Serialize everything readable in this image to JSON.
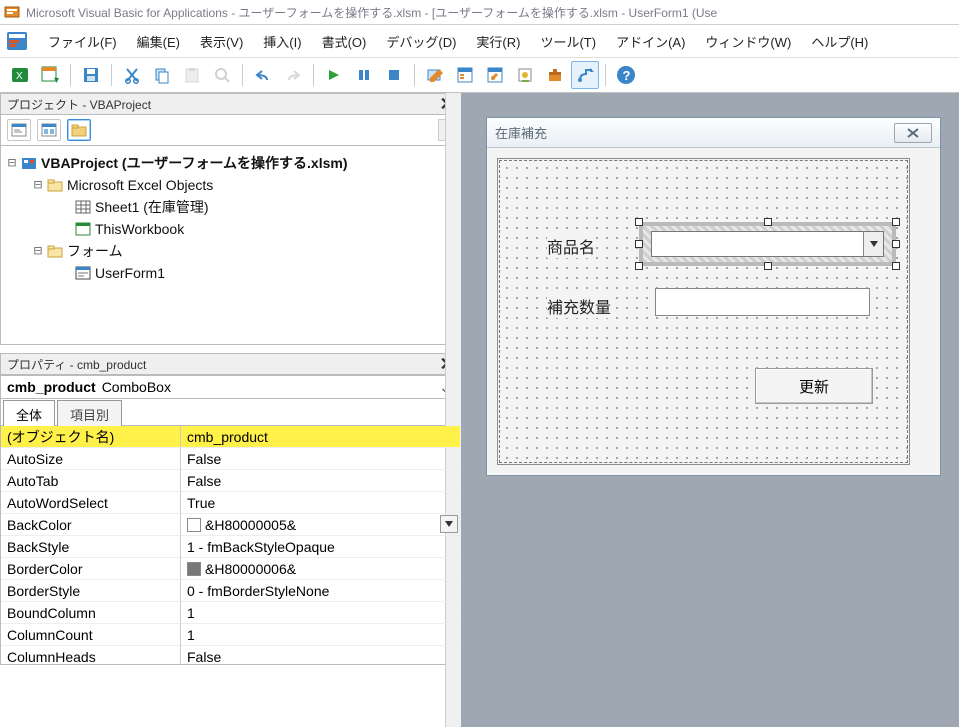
{
  "title": "Microsoft Visual Basic for Applications - ユーザーフォームを操作する.xlsm - [ユーザーフォームを操作する.xlsm - UserForm1 (Use",
  "menu": {
    "file": "ファイル(F)",
    "edit": "編集(E)",
    "view": "表示(V)",
    "insert": "挿入(I)",
    "format": "書式(O)",
    "debug": "デバッグ(D)",
    "run": "実行(R)",
    "tools": "ツール(T)",
    "addins": "アドイン(A)",
    "window": "ウィンドウ(W)",
    "help": "ヘルプ(H)"
  },
  "panels": {
    "project_title": "プロジェクト - VBAProject",
    "properties_title": "プロパティ - cmb_product"
  },
  "tree": {
    "root": "VBAProject (ユーザーフォームを操作する.xlsm)",
    "excel_objects": "Microsoft Excel Objects",
    "sheet1": "Sheet1 (在庫管理)",
    "thiswb": "ThisWorkbook",
    "forms": "フォーム",
    "userform1": "UserForm1"
  },
  "props": {
    "object_name": "cmb_product",
    "object_type": "ComboBox",
    "tab_all": "全体",
    "tab_cat": "項目別",
    "rows": [
      {
        "k": "(オブジェクト名)",
        "v": "cmb_product",
        "hl": true
      },
      {
        "k": "AutoSize",
        "v": "False"
      },
      {
        "k": "AutoTab",
        "v": "False"
      },
      {
        "k": "AutoWordSelect",
        "v": "True"
      },
      {
        "k": "BackColor",
        "v": "&H80000005&",
        "chip": "white",
        "dd": true
      },
      {
        "k": "BackStyle",
        "v": "1 - fmBackStyleOpaque"
      },
      {
        "k": "BorderColor",
        "v": "&H80000006&",
        "chip": "gray"
      },
      {
        "k": "BorderStyle",
        "v": "0 - fmBorderStyleNone"
      },
      {
        "k": "BoundColumn",
        "v": "1"
      },
      {
        "k": "ColumnCount",
        "v": "1"
      },
      {
        "k": "ColumnHeads",
        "v": "False"
      }
    ]
  },
  "form": {
    "caption": "在庫補充",
    "lbl_product": "商品名",
    "lbl_qty": "補充数量",
    "update_btn": "更新"
  }
}
